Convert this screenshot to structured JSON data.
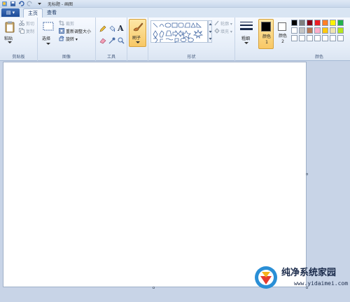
{
  "window": {
    "title": "无标题 - 画图"
  },
  "tabs": {
    "file_label": "▤ ▾",
    "home": "主页",
    "view": "查看"
  },
  "clipboard": {
    "paste": "粘贴",
    "cut": "剪切",
    "copy": "复制",
    "group": "剪贴板"
  },
  "image": {
    "select": "选择",
    "crop": "裁剪",
    "resize": "重新调整大小",
    "rotate": "旋转 ▾",
    "group": "图像"
  },
  "tools": {
    "group": "工具"
  },
  "brushes": {
    "label": "刷子"
  },
  "shapes": {
    "outline": "轮廓 ▾",
    "fill": "填充 ▾",
    "group": "形状"
  },
  "size": {
    "label": "粗细"
  },
  "colors": {
    "color1": "颜色 1",
    "color2": "颜色 2",
    "group": "颜色",
    "color1_value": "#000000",
    "color2_value": "#ffffff",
    "swatches_row1": [
      "#000000",
      "#7f7f7f",
      "#880015",
      "#ed1c24",
      "#ff7f27",
      "#fff200",
      "#22b14c"
    ],
    "swatches_row2": [
      "#ffffff",
      "#c3c3c3",
      "#b97a57",
      "#ffaec9",
      "#ffc90e",
      "#efe4b0",
      "#b5e61d"
    ],
    "swatches_row3": [
      "#ffffff",
      "#ffffff",
      "#ffffff",
      "#ffffff",
      "#ffffff",
      "#ffffff",
      "#ffffff"
    ]
  },
  "watermark": {
    "title": "纯净系统家园",
    "url": "www.yidaimei.com"
  }
}
